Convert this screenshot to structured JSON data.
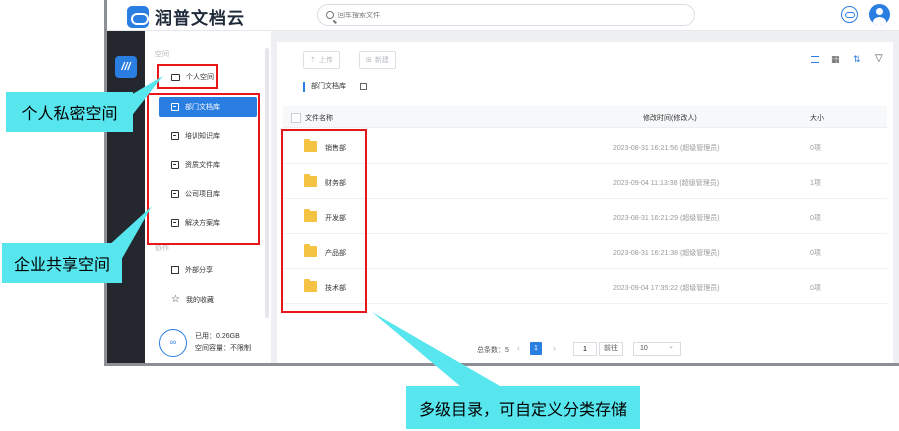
{
  "app": {
    "brand": "润普文档云"
  },
  "search": {
    "placeholder": "回车搜索文件"
  },
  "sidebar": {
    "sections": {
      "space": "空间",
      "other": "协作"
    },
    "personal": "个人空间",
    "enterprise_items": [
      {
        "label": "部门文档库"
      },
      {
        "label": "培训知识库"
      },
      {
        "label": "资质文件库"
      },
      {
        "label": "公司项目库"
      },
      {
        "label": "解决方案库"
      }
    ],
    "share": "外部分享",
    "favorites": "我的收藏",
    "storage": {
      "ring": "∞",
      "used": "已用：0.26GB",
      "capacity": "空间容量：不限制"
    }
  },
  "toolbar": {
    "upload": "上传",
    "new": "新建"
  },
  "breadcrumb": "部门文档库",
  "table": {
    "headers": {
      "name": "文件名称",
      "time": "修改时间(修改人)",
      "size": "大小"
    },
    "rows": [
      {
        "name": "销售部",
        "time": "2023-08-31 16:21:56 (超级管理员)",
        "size": "0项"
      },
      {
        "name": "财务部",
        "time": "2023-09-04 11:13:38 (超级管理员)",
        "size": "1项"
      },
      {
        "name": "开发部",
        "time": "2023-08-31 16:21:29 (超级管理员)",
        "size": "0项"
      },
      {
        "name": "产品部",
        "time": "2023-08-31 16:21:38 (超级管理员)",
        "size": "0项"
      },
      {
        "name": "技术部",
        "time": "2023-09-04 17:35:22 (超级管理员)",
        "size": "0项"
      }
    ]
  },
  "pager": {
    "total": "总条数：5",
    "current": "1",
    "goto_value": "1",
    "goto": "前往",
    "page_size": "10"
  },
  "annotations": {
    "personal": "个人私密空间",
    "enterprise": "企业共享空间",
    "folders": "多级目录，可自定义分类存储"
  },
  "colors": {
    "accent": "#2a7de1",
    "callout": "#57e5ee",
    "highlight": "#e8151b",
    "folder": "#f5c343"
  }
}
